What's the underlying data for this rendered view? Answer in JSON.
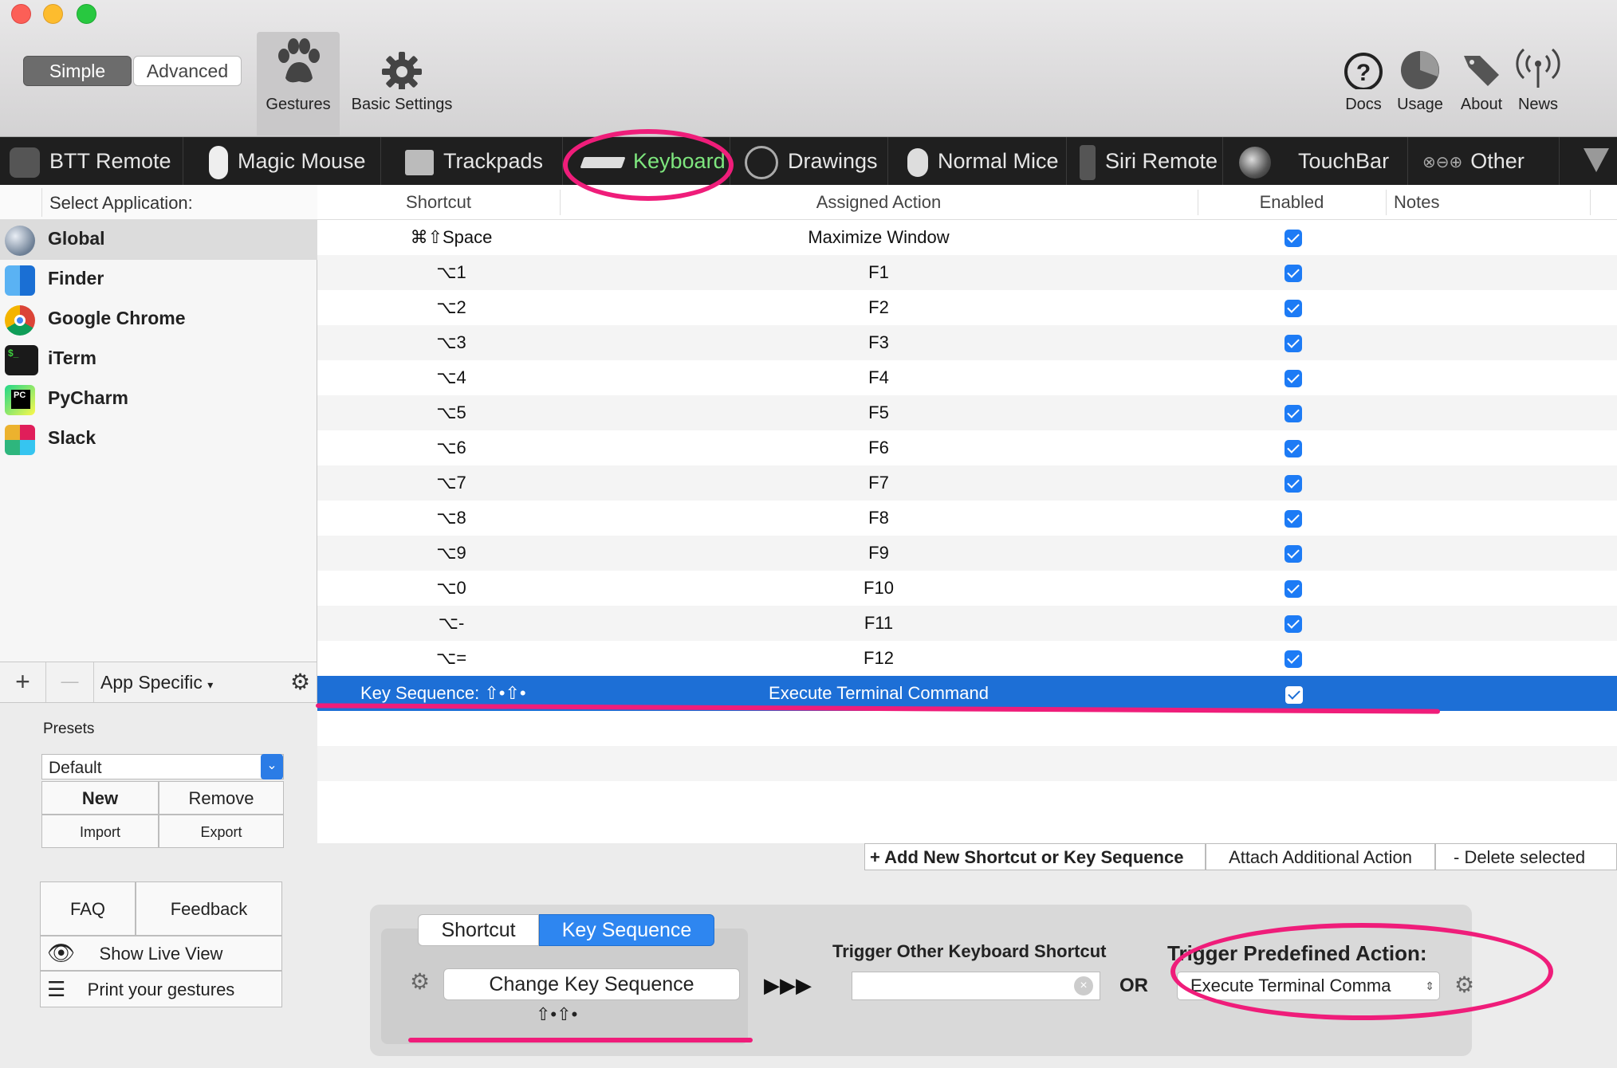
{
  "toolbar": {
    "mode_simple": "Simple",
    "mode_advanced": "Advanced",
    "gestures_label": "Gestures",
    "basic_settings_label": "Basic Settings",
    "docs_label": "Docs",
    "usage_label": "Usage",
    "about_label": "About",
    "news_label": "News"
  },
  "tabs": {
    "btt_remote": "BTT Remote",
    "magic_mouse": "Magic Mouse",
    "trackpads": "Trackpads",
    "keyboard": "Keyboard",
    "drawings": "Drawings",
    "normal_mice": "Normal Mice",
    "siri_remote": "Siri Remote",
    "touchbar": "TouchBar",
    "other": "Other"
  },
  "sidebar": {
    "header": "Select Application:",
    "apps": [
      "Global",
      "Finder",
      "Google Chrome",
      "iTerm",
      "PyCharm",
      "Slack"
    ],
    "add_symbol": "+",
    "remove_symbol": "—",
    "app_specific": "App Specific"
  },
  "table": {
    "col_shortcut": "Shortcut",
    "col_action": "Assigned Action",
    "col_enabled": "Enabled",
    "col_notes": "Notes",
    "rows": [
      {
        "shortcut": "⌘⇧Space",
        "action": "Maximize Window"
      },
      {
        "shortcut": "⌥1",
        "action": "F1"
      },
      {
        "shortcut": "⌥2",
        "action": "F2"
      },
      {
        "shortcut": "⌥3",
        "action": "F3"
      },
      {
        "shortcut": "⌥4",
        "action": "F4"
      },
      {
        "shortcut": "⌥5",
        "action": "F5"
      },
      {
        "shortcut": "⌥6",
        "action": "F6"
      },
      {
        "shortcut": "⌥7",
        "action": "F7"
      },
      {
        "shortcut": "⌥8",
        "action": "F8"
      },
      {
        "shortcut": "⌥9",
        "action": "F9"
      },
      {
        "shortcut": "⌥0",
        "action": "F10"
      },
      {
        "shortcut": "⌥-",
        "action": "F11"
      },
      {
        "shortcut": "⌥=",
        "action": "F12"
      },
      {
        "shortcut": "Key Sequence: ⇧•⇧•",
        "action": "Execute Terminal Command"
      }
    ],
    "add_new": "+ Add New Shortcut or Key Sequence",
    "attach": "Attach Additional Action",
    "delete": "- Delete selected"
  },
  "presets": {
    "label": "Presets",
    "selected": "Default",
    "new": "New",
    "remove": "Remove",
    "import": "Import",
    "export": "Export",
    "faq": "FAQ",
    "feedback": "Feedback",
    "live_view": "Show Live View",
    "print": "Print your gestures"
  },
  "config": {
    "seg_shortcut": "Shortcut",
    "seg_key_sequence": "Key Sequence",
    "change_button": "Change Key Sequence",
    "sequence_display": "⇧•⇧•",
    "arrows": "▶▶▶",
    "trigger_other_label": "Trigger Other Keyboard Shortcut",
    "or_label": "OR",
    "trigger_predefined_label": "Trigger Predefined Action:",
    "predefined_value": "Execute Terminal Comma"
  },
  "colors": {
    "accent": "#1d6fd6",
    "annotation": "#ef1d7a",
    "tabbar": "#1f1f1f"
  }
}
